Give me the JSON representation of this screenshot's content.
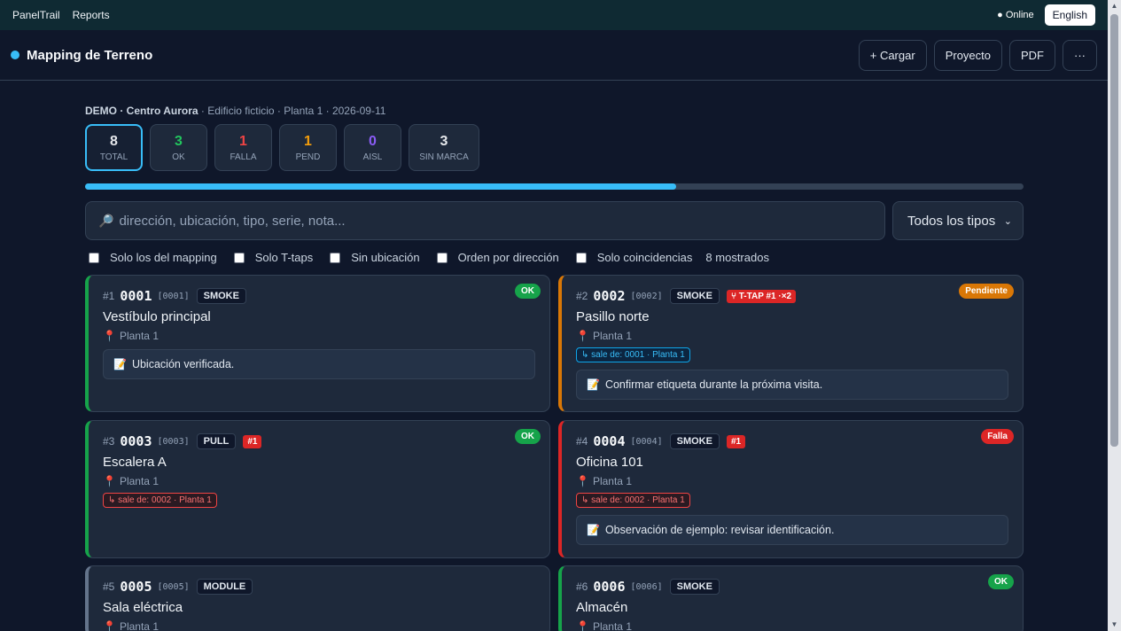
{
  "topbar": {
    "nav": [
      "PanelTrail",
      "Reports"
    ],
    "online": "● Online",
    "lang": "English"
  },
  "header": {
    "title": "Mapping de Terreno",
    "buttons": [
      "+ Cargar",
      "Proyecto",
      "PDF",
      "···"
    ]
  },
  "meta": {
    "demo": "DEMO · Centro Aurora",
    "rest": " · Edificio ficticio · Planta 1 · 2026-09-11"
  },
  "stats": [
    {
      "num": "8",
      "label": "TOTAL",
      "color": "#e5e7eb"
    },
    {
      "num": "3",
      "label": "OK",
      "color": "#22c55e"
    },
    {
      "num": "1",
      "label": "FALLA",
      "color": "#ef4444"
    },
    {
      "num": "1",
      "label": "PEND",
      "color": "#f59e0b"
    },
    {
      "num": "0",
      "label": "AISL",
      "color": "#8b5cf6"
    },
    {
      "num": "3",
      "label": "SIN MARCA",
      "color": "#e5e7eb"
    }
  ],
  "progress": 0.63,
  "search": {
    "placeholder": "dirección, ubicación, tipo, serie, nota...",
    "type_select": "Todos los tipos"
  },
  "filters": [
    "Solo los del mapping",
    "Solo T-taps",
    "Sin ubicación",
    "Orden por dirección",
    "Solo coincidencias"
  ],
  "shown": "8 mostrados",
  "cards": [
    {
      "idx": "#1",
      "code": "0001",
      "ser": "[0001]",
      "type": "SMOKE",
      "flag": "",
      "status": "OK",
      "status_color": "#16a34a",
      "border": "#16a34a",
      "name": "Vestíbulo principal",
      "loc": "Planta 1",
      "link": "",
      "link_class": "",
      "note": "Ubicación verificada."
    },
    {
      "idx": "#2",
      "code": "0002",
      "ser": "[0002]",
      "type": "SMOKE",
      "flag": "⑂ T-TAP #1 ·×2",
      "status": "Pendiente",
      "status_color": "#d97706",
      "border": "#d97706",
      "name": "Pasillo norte",
      "loc": "Planta 1",
      "link": "↳ sale de: 0001 · Planta 1",
      "link_class": "blue",
      "note": "Confirmar etiqueta durante la próxima visita."
    },
    {
      "idx": "#3",
      "code": "0003",
      "ser": "[0003]",
      "type": "PULL",
      "flag": "#1",
      "status": "OK",
      "status_color": "#16a34a",
      "border": "#16a34a",
      "name": "Escalera A",
      "loc": "Planta 1",
      "link": "↳ sale de: 0002 · Planta 1",
      "link_class": "red",
      "note": ""
    },
    {
      "idx": "#4",
      "code": "0004",
      "ser": "[0004]",
      "type": "SMOKE",
      "flag": "#1",
      "status": "Falla",
      "status_color": "#dc2626",
      "border": "#dc2626",
      "name": "Oficina 101",
      "loc": "Planta 1",
      "link": "↳ sale de: 0002 · Planta 1",
      "link_class": "red",
      "note": "Observación de ejemplo: revisar identificación."
    },
    {
      "idx": "#5",
      "code": "0005",
      "ser": "[0005]",
      "type": "MODULE",
      "flag": "",
      "status": "",
      "status_color": "",
      "border": "#64748b",
      "name": "Sala eléctrica",
      "loc": "Planta 1",
      "link": "",
      "link_class": "",
      "note": ""
    },
    {
      "idx": "#6",
      "code": "0006",
      "ser": "[0006]",
      "type": "SMOKE",
      "flag": "",
      "status": "OK",
      "status_color": "#16a34a",
      "border": "#16a34a",
      "name": "Almacén",
      "loc": "Planta 1",
      "link": "",
      "link_class": "",
      "note": ""
    }
  ]
}
